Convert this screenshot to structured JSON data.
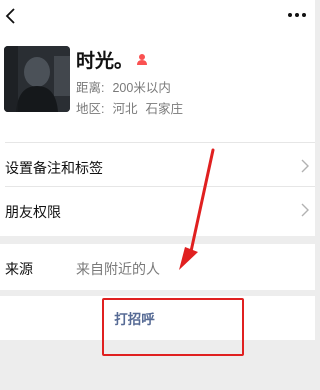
{
  "profile": {
    "nickname": "时光。",
    "distance_label": "距离:",
    "distance_value": "200米以内",
    "region_label": "地区:",
    "region_province": "河北",
    "region_city": "石家庄",
    "gender": "female",
    "gender_color": "#fa5151"
  },
  "menu": {
    "remark_label": "设置备注和标签",
    "friend_permission_label": "朋友权限",
    "source_label": "来源",
    "source_value": "来自附近的人"
  },
  "actions": {
    "greet_label": "打招呼",
    "link_color": "#576b95"
  },
  "annotation": {
    "color": "#e02020"
  }
}
